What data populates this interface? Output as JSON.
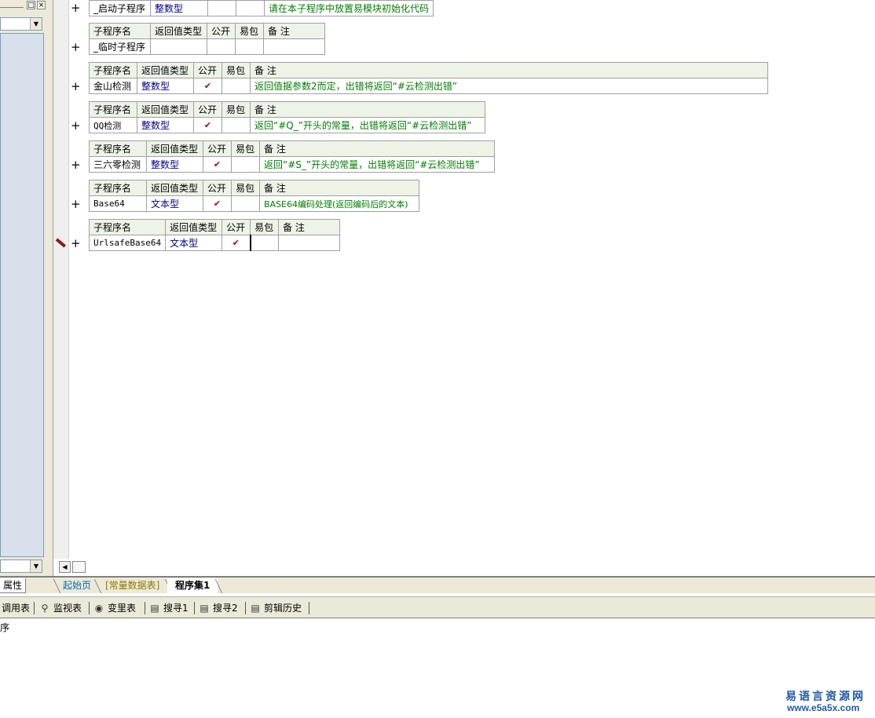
{
  "left_panel": {
    "min_glyph": "□",
    "close_glyph": "×",
    "drop_glyph": "▼"
  },
  "columns": {
    "name": "子程序名",
    "return_type": "返回值类型",
    "public": "公开",
    "easy_pack": "易包",
    "note": "备 注"
  },
  "check_glyph": "✔",
  "plus_glyph": "+",
  "subroutines": [
    {
      "name": "_启动子程序",
      "type": "整数型",
      "public": false,
      "easy_pack": false,
      "note": "请在本子程序中放置易模块初始化代码"
    },
    {
      "name": "_临时子程序",
      "type": "",
      "public": false,
      "easy_pack": false,
      "note": ""
    },
    {
      "name": "金山检测",
      "type": "整数型",
      "public": true,
      "easy_pack": false,
      "note": "返回值据参数2而定，出错将返回“#云检测出错”"
    },
    {
      "name": "QQ检测",
      "type": "整数型",
      "public": true,
      "easy_pack": false,
      "note": "返回“#Q_”开头的常量，出错将返回“#云检测出错”"
    },
    {
      "name": "三六零检测",
      "type": "整数型",
      "public": true,
      "easy_pack": false,
      "note": "返回“#S_”开头的常量，出错将返回“#云检测出错”"
    },
    {
      "name": "Base64",
      "type": "文本型",
      "public": true,
      "easy_pack": false,
      "note": "BASE64编码处理(返回编码后的文本)"
    },
    {
      "name": "UrlsafeBase64",
      "type": "文本型",
      "public": true,
      "easy_pack": false,
      "note": ""
    }
  ],
  "tabs": {
    "properties": "属性",
    "start_page": "起始页",
    "const_table": "[常量数据表]",
    "program_set": "程序集1"
  },
  "toolbar": [
    {
      "label": "调用表",
      "icon": ""
    },
    {
      "label": "监视表",
      "icon": "search-icon"
    },
    {
      "label": "变里表",
      "icon": "binoculars-icon"
    },
    {
      "label": "搜寻1",
      "icon": "find-icon"
    },
    {
      "label": "搜寻2",
      "icon": "find-icon"
    },
    {
      "label": "剪辑历史",
      "icon": "clipboard-icon"
    }
  ],
  "output": {
    "text": "序"
  },
  "watermark": {
    "cn": "易语言资源网",
    "url": "www.e5a5x.com"
  }
}
